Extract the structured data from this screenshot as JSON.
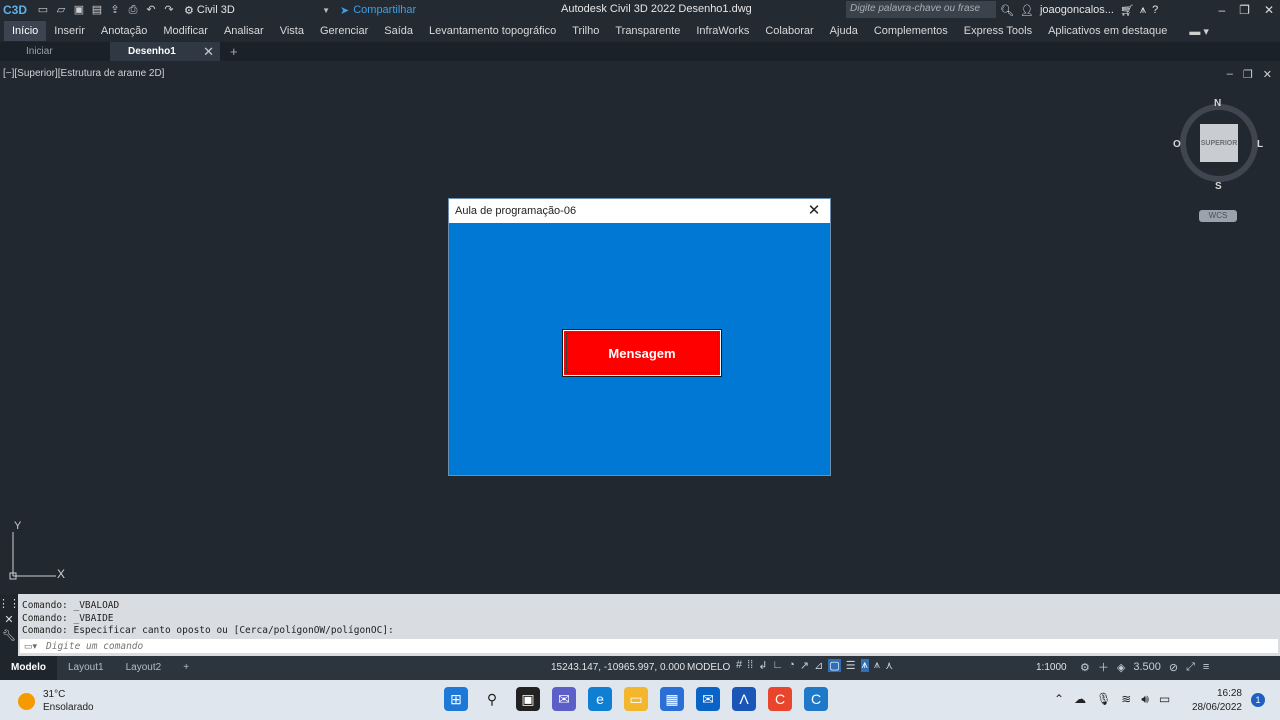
{
  "titlebar": {
    "app_logo": "C3D",
    "workspace": "Civil 3D",
    "share": "Compartilhar",
    "title": "Autodesk Civil 3D 2022    Desenho1.dwg",
    "search_placeholder": "Digite palavra-chave ou frase",
    "user": "joaogoncalos...",
    "win_controls": [
      "–",
      "❐",
      "✕"
    ]
  },
  "menu": {
    "items": [
      "Início",
      "Inserir",
      "Anotação",
      "Modificar",
      "Analisar",
      "Vista",
      "Gerenciar",
      "Saída",
      "Levantamento topográfico",
      "Trilho",
      "Transparente",
      "InfraWorks",
      "Colaborar",
      "Ajuda",
      "Complementos",
      "Express Tools",
      "Aplicativos em destaque"
    ],
    "active_index": 0
  },
  "doctabs": {
    "start": "Iniciar",
    "active": "Desenho1",
    "close": "✕",
    "add": "+"
  },
  "viewport": {
    "label": "[−][Superior][Estrutura de arame 2D]",
    "viewcube": {
      "face": "SUPERIOR",
      "n": "N",
      "s": "S",
      "w": "O",
      "e": "L",
      "wcs": "WCS"
    },
    "ucs": {
      "y": "Y",
      "x": "X"
    }
  },
  "dialog": {
    "title": "Aula de programação-06",
    "button": "Mensagem",
    "close": "✕"
  },
  "command": {
    "history": [
      "Comando:  _VBALOAD",
      "Comando:  _VBAIDE",
      "Comando:  Especificar canto oposto ou [Cerca/polígonOW/polígonOC]:"
    ],
    "placeholder": "Digite um comando"
  },
  "statusbar": {
    "tabs": [
      "Modelo",
      "Layout1",
      "Layout2"
    ],
    "add": "+",
    "coords": "15243.147, -10965.997, 0.000",
    "model": "MODELO",
    "scale": "1:1000",
    "annotation_scale": "3.500"
  },
  "taskbar": {
    "temp": "31°C",
    "condition": "Ensolarado",
    "time": "16:28",
    "date": "28/06/2022",
    "notifications": "1"
  }
}
